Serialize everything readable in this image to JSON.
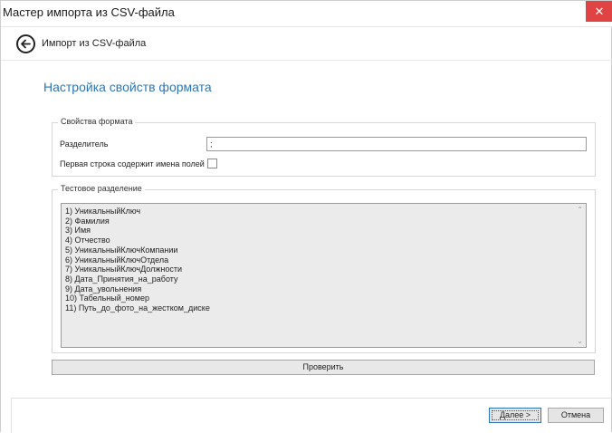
{
  "window": {
    "title": "Мастер импорта из CSV-файла",
    "close_symbol": "✕"
  },
  "header": {
    "crumb": "Импорт из CSV-файла"
  },
  "page": {
    "title": "Настройка свойств формата"
  },
  "format_group": {
    "legend": "Свойства формата",
    "separator_label": "Разделитель",
    "separator_value": ";",
    "first_row_label": "Первая строка содержит имена полей",
    "first_row_checked": false
  },
  "preview_group": {
    "legend": "Тестовое разделение",
    "lines": [
      "1) УникальныйКлюч",
      "2) Фамилия",
      "3) Имя",
      "4) Отчество",
      "5) УникальныйКлючКомпании",
      "6) УникальныйКлючОтдела",
      "7) УникальныйКлючДолжности",
      "8) Дата_Принятия_на_работу",
      "9) Дата_увольнения",
      "10) Табельный_номер",
      "11) Путь_до_фото_на_жестком_диске"
    ]
  },
  "buttons": {
    "check": "Проверить",
    "next": "Далее >",
    "cancel": "Отмена"
  }
}
